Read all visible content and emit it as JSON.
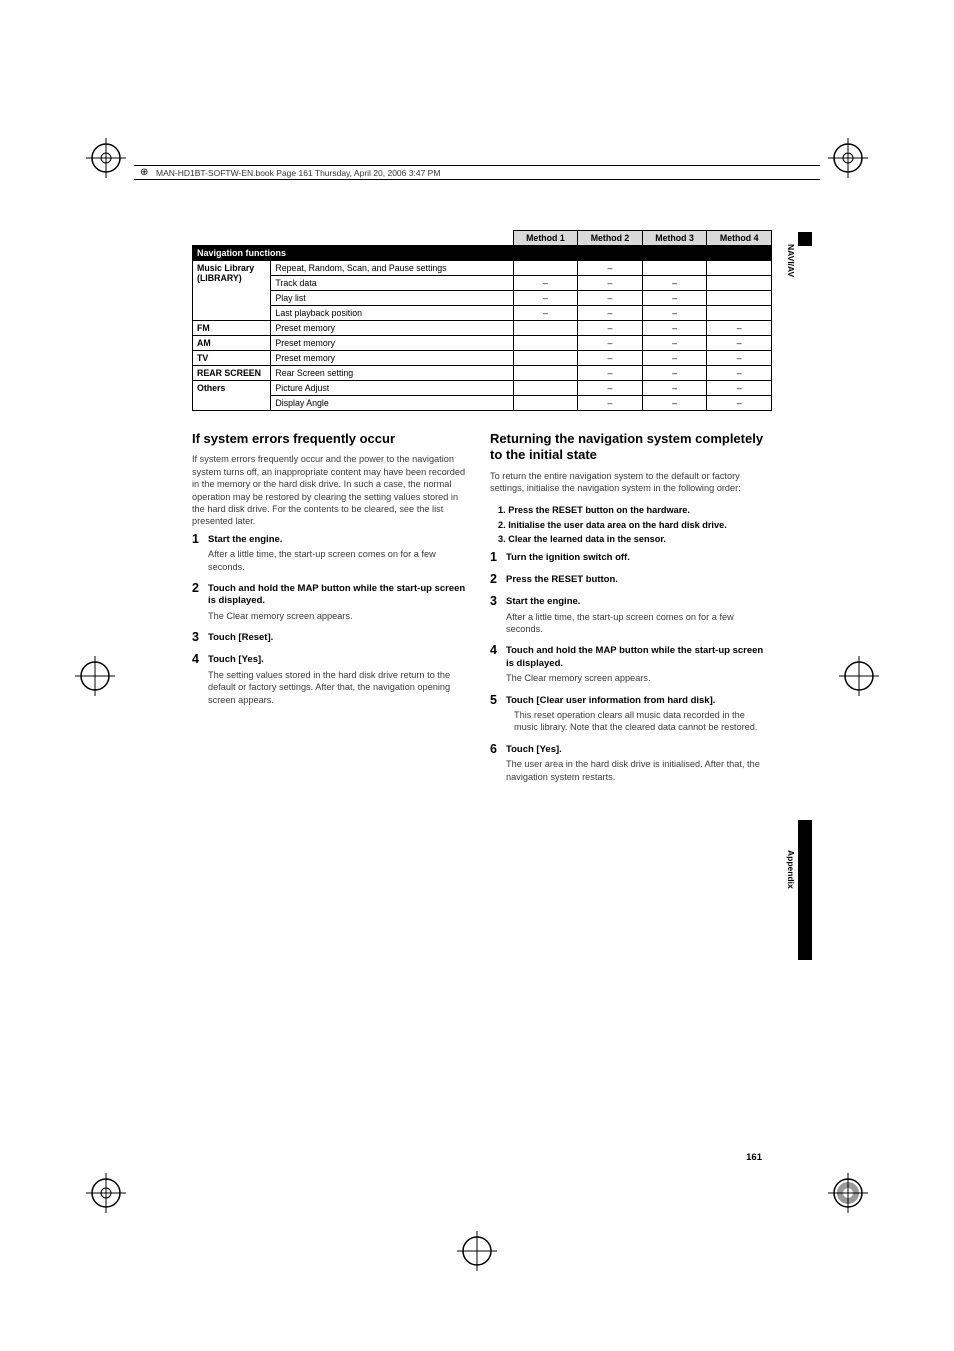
{
  "header": {
    "running_text": "MAN-HD1BT-SOFTW-EN.book  Page 161  Thursday, April 20, 2006  3:47 PM"
  },
  "table": {
    "headers": [
      "Method 1",
      "Method 2",
      "Method 3",
      "Method 4"
    ],
    "section_header": "Navigation functions",
    "rows": [
      {
        "label_html": "Music Library (<b>LIBRARY</b>)",
        "rowspan": 4,
        "desc": "Repeat, Random, Scan, and Pause settings",
        "m1": "",
        "m2": "–",
        "m3": "",
        "m4": ""
      },
      {
        "desc": "Track data",
        "m1": "–",
        "m2": "–",
        "m3": "–",
        "m4": ""
      },
      {
        "desc": "Play list",
        "m1": "–",
        "m2": "–",
        "m3": "–",
        "m4": ""
      },
      {
        "desc": "Last playback position",
        "m1": "–",
        "m2": "–",
        "m3": "–",
        "m4": ""
      },
      {
        "label_html": "<b>FM</b>",
        "desc": "Preset memory",
        "m1": "",
        "m2": "–",
        "m3": "–",
        "m4": "–"
      },
      {
        "label_html": "<b>AM</b>",
        "desc": "Preset memory",
        "m1": "",
        "m2": "–",
        "m3": "–",
        "m4": "–"
      },
      {
        "label_html": "<b>TV</b>",
        "desc": "Preset memory",
        "m1": "",
        "m2": "–",
        "m3": "–",
        "m4": "–"
      },
      {
        "label_html": "<b>REAR SCREEN</b>",
        "desc": "Rear Screen setting",
        "m1": "",
        "m2": "–",
        "m3": "–",
        "m4": "–"
      },
      {
        "label_html": "Others",
        "rowspan": 2,
        "desc": "Picture Adjust",
        "m1": "",
        "m2": "–",
        "m3": "–",
        "m4": "–"
      },
      {
        "desc": "Display Angle",
        "m1": "",
        "m2": "–",
        "m3": "–",
        "m4": "–"
      }
    ]
  },
  "sideLabels": {
    "navi": "NAVI/AV",
    "appendix": "Appendix"
  },
  "left": {
    "heading": "If system errors frequently occur",
    "intro": "If system errors frequently occur and the power to the navigation system turns off, an inappropriate content may have been recorded in the memory or the hard disk drive. In such a case, the normal operation may be restored by clearing the setting values stored in the hard disk drive. For the contents to be cleared, see the list presented later.",
    "steps": [
      {
        "n": "1",
        "title": "Start the engine.",
        "body": "After a little time, the start-up screen comes on for a few seconds."
      },
      {
        "n": "2",
        "title": "Touch and hold the MAP button while the start-up screen is displayed.",
        "body": "The Clear memory screen appears."
      },
      {
        "n": "3",
        "title": "Touch [Reset].",
        "body": ""
      },
      {
        "n": "4",
        "title": "Touch [Yes].",
        "body": "The setting values stored in the hard disk drive return to the default or factory settings. After that, the navigation opening screen appears."
      }
    ]
  },
  "right": {
    "heading": "Returning the navigation system completely to the initial state",
    "intro": "To return the entire navigation system to the default or factory settings, initialise the navigation system in the following order:",
    "substeps": [
      "1. Press the RESET button on the hardware.",
      "2. Initialise the user data area on the hard disk drive.",
      "3. Clear the learned data in the sensor."
    ],
    "steps": [
      {
        "n": "1",
        "title": "Turn the ignition switch off.",
        "body": ""
      },
      {
        "n": "2",
        "title": "Press the RESET button.",
        "body": ""
      },
      {
        "n": "3",
        "title": "Start the engine.",
        "body": "After a little time, the start-up screen comes on for a few seconds."
      },
      {
        "n": "4",
        "title": "Touch and hold the MAP button while the start-up screen is displayed.",
        "body": "The Clear memory screen appears."
      },
      {
        "n": "5",
        "title": "Touch [Clear user information from hard disk].",
        "body": "This reset operation clears all music data recorded in the music library. Note that the cleared data cannot be restored.",
        "indent": true
      },
      {
        "n": "6",
        "title": "Touch [Yes].",
        "body": "The user area in the hard disk drive is initialised. After that, the navigation system restarts."
      }
    ]
  },
  "pageNumber": "161"
}
